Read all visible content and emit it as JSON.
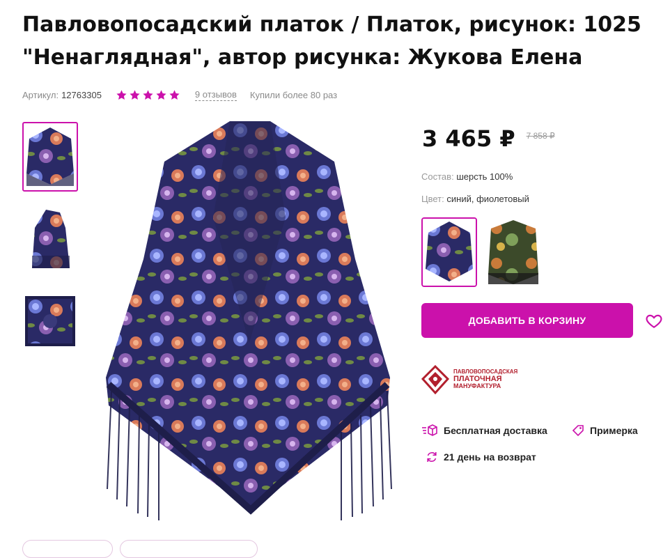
{
  "product": {
    "title": "Павловопосадский платок / Платок, рисунок: 1025 \"Ненаглядная\", автор рисунка: Жукова Елена",
    "article_label": "Артикул:",
    "article_value": "12763305",
    "rating_stars": 5,
    "reviews": "9 отзывов",
    "bought": "Купили более 80 раз"
  },
  "price": {
    "current": "3 465 ₽",
    "old": "7 858 ₽"
  },
  "props": {
    "composition_label": "Состав:",
    "composition_value": "шерсть 100%",
    "color_label": "Цвет:",
    "color_value": "синий, фиолетовый"
  },
  "actions": {
    "add_to_cart": "ДОБАВИТЬ В КОРЗИНУ"
  },
  "brand": {
    "line1": "ПАВЛОВОПОСАДСКАЯ",
    "line2": "ПЛАТОЧНАЯ",
    "line3": "МАНУФАКТУРА"
  },
  "features": {
    "delivery": "Бесплатная доставка",
    "fitting": "Примерка",
    "return": "21 день на возврат"
  },
  "colors": {
    "accent": "#cb11ab",
    "star": "#cb11ab",
    "brand_red": "#b21f2d"
  }
}
